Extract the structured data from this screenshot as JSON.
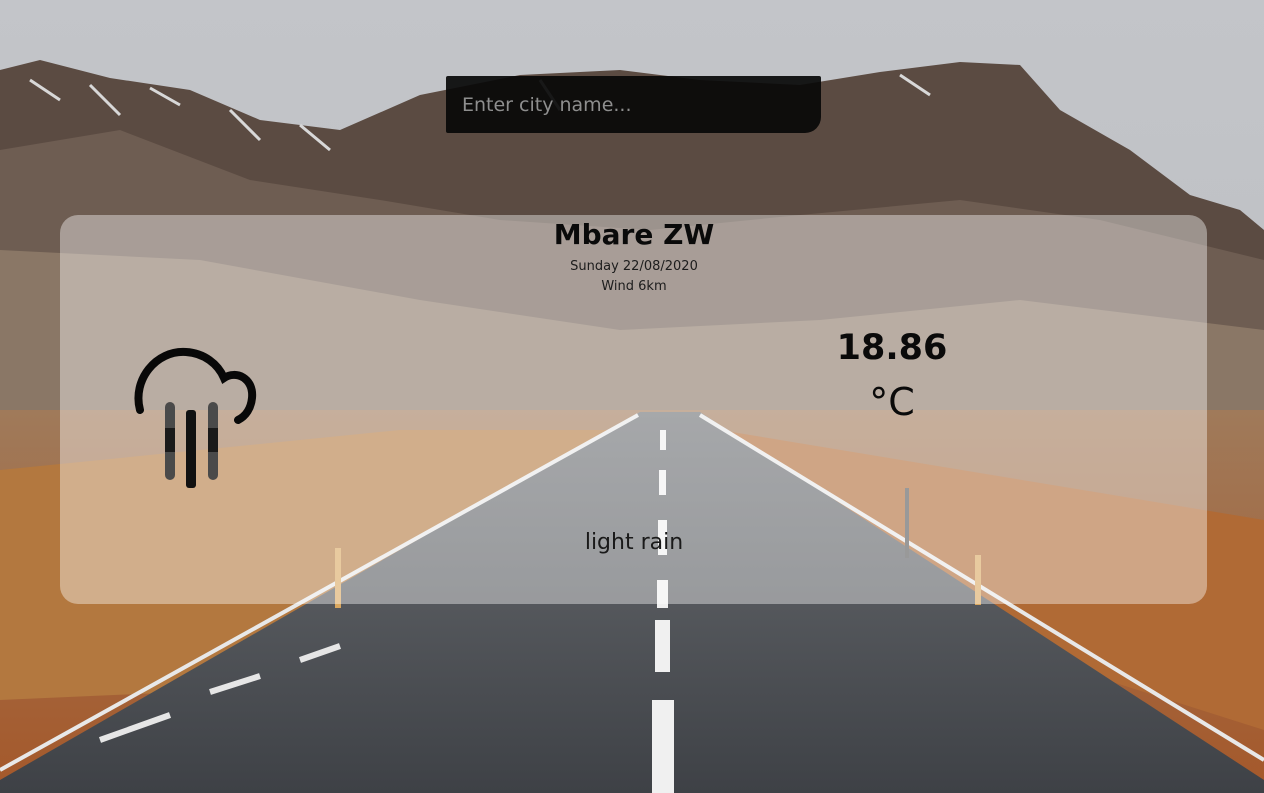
{
  "search": {
    "placeholder": "Enter city name...",
    "value": ""
  },
  "weather": {
    "city": "Mbare ZW",
    "date": "Sunday 22/08/2020",
    "wind": "Wind 6km",
    "temperature": "18.86",
    "unit": "°C",
    "description": "light rain",
    "icon": "rain-cloud-icon"
  },
  "colors": {
    "search_background": "#080808",
    "card_background": "rgba(255,255,255,0.40)",
    "text": "#0a0a0a"
  },
  "background": "mountain-road-photo"
}
